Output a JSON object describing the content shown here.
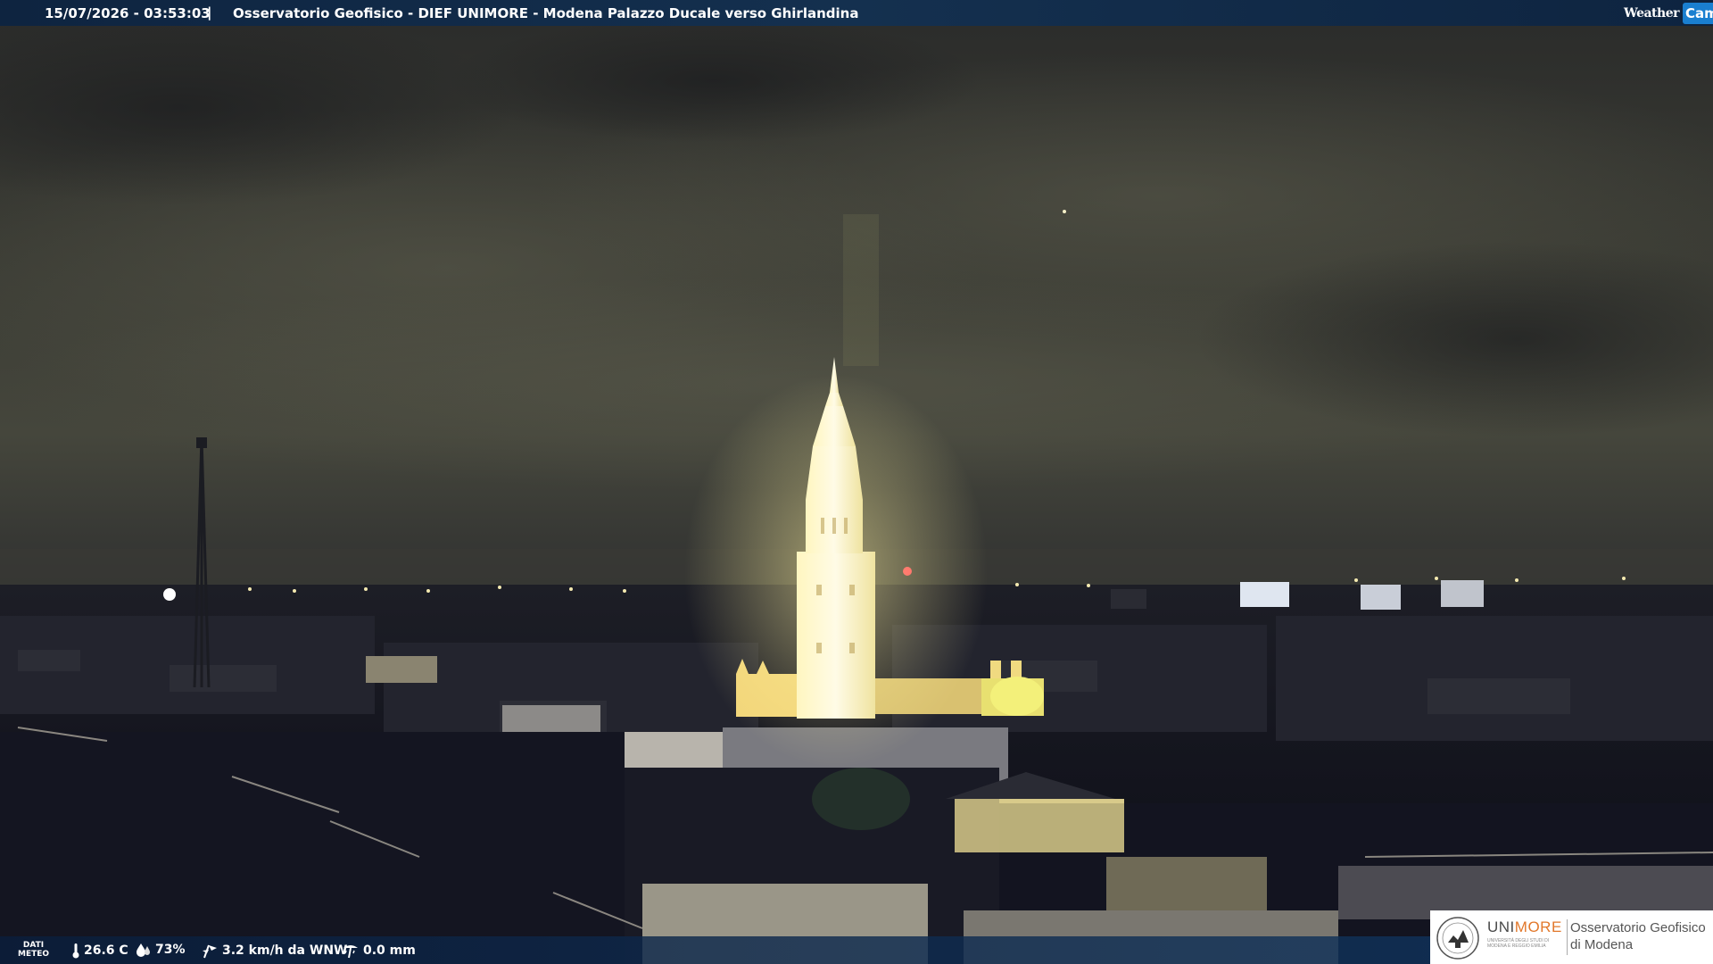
{
  "header": {
    "timestamp": "15/07/2026 - 03:53:03",
    "separator": "|",
    "caption": "Osservatorio Geofisico - DIEF UNIMORE - Modena Palazzo Ducale verso Ghirlandina"
  },
  "brand": {
    "logo_word": "Weather",
    "logo_cam": "Cam"
  },
  "meteo": {
    "label_line1": "DATI",
    "label_line2": "METEO",
    "temperature": "26.6 C",
    "humidity": "73%",
    "wind": "3.2 km/h da WNW",
    "rain": "0.0 mm",
    "icons": [
      "thermometer-icon",
      "humidity-drop-icon",
      "wind-icon",
      "rain-gauge-icon"
    ]
  },
  "institution": {
    "uni_prefix": "UNI",
    "uni_suffix": "MORE",
    "uni_subtitle": "UNIVERSITÀ DEGLI STUDI DI MODENA E REGGIO EMILIA",
    "observatory_line1": "Osservatorio Geofisico",
    "observatory_line2": "di Modena",
    "accent_color": "#e2782b"
  },
  "colors": {
    "sky_top": "#2b2c28",
    "sky_glow": "#4a4a3e",
    "tower_light": "#fff7c8",
    "bar_blue": "#14304f"
  }
}
